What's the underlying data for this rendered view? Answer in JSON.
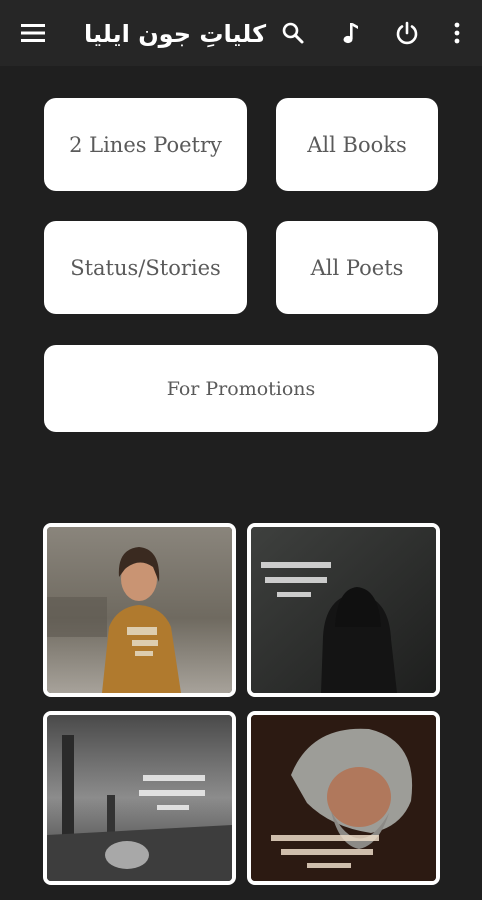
{
  "app": {
    "title": "کلیاتِ جون ایلیا",
    "toolbar_icons": [
      "menu-icon",
      "search-icon",
      "music-note-icon",
      "power-icon",
      "more-vert-icon"
    ]
  },
  "menu": {
    "two_lines_poetry": "2 Lines Poetry",
    "all_books": "All Books",
    "status_stories": "Status/Stories",
    "all_poets": "All Poets",
    "for_promotions": "For Promotions"
  },
  "gallery": {
    "items": [
      {
        "subject": "girl-with-poetry-overlay"
      },
      {
        "subject": "hooded-figure-with-poetry-overlay"
      },
      {
        "subject": "foggy-landscape-with-poetry-overlay"
      },
      {
        "subject": "old-man-with-poetry-overlay"
      }
    ]
  },
  "colors": {
    "background": "#1f1f1f",
    "appbar": "#262626",
    "tile": "#ffffff",
    "tile_text": "#5a5a5a"
  }
}
